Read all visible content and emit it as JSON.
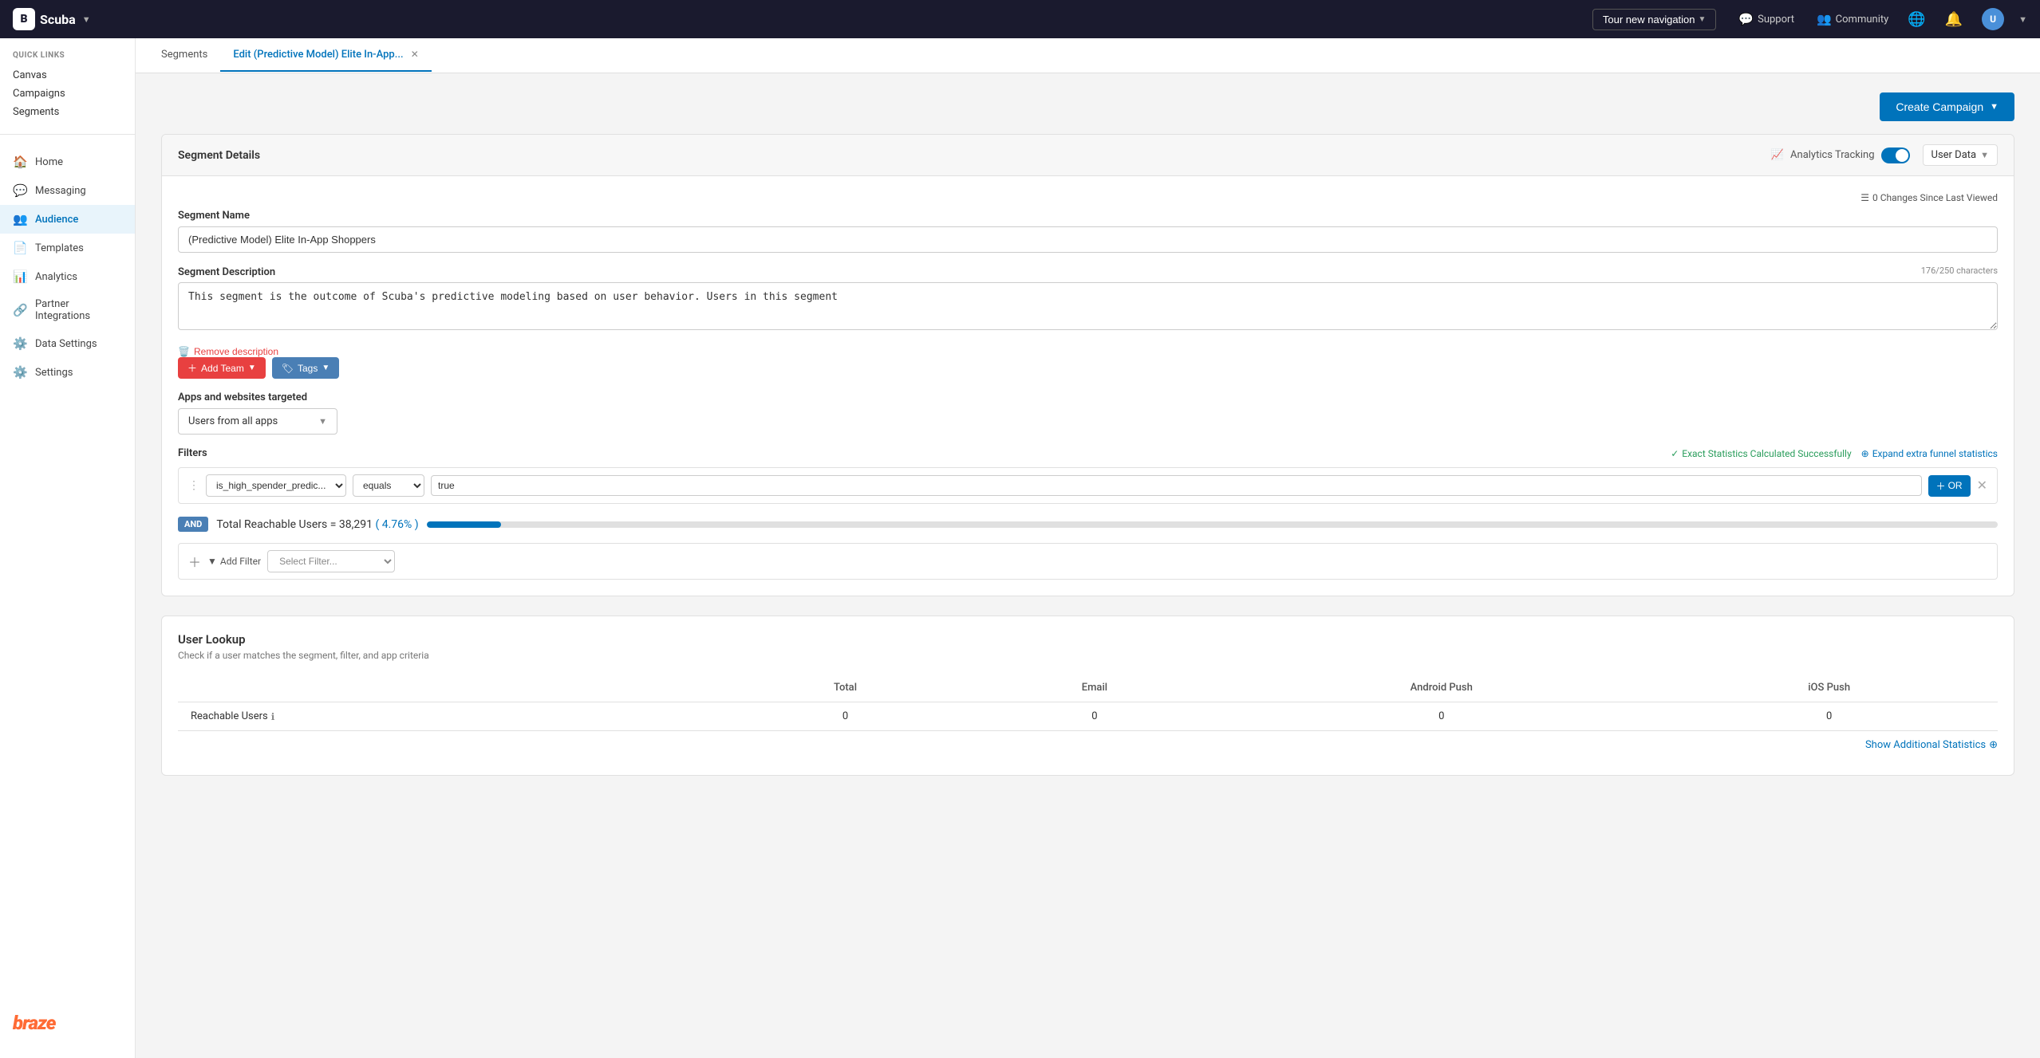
{
  "topNav": {
    "logoText": "B",
    "orgName": "Scuba",
    "tourLabel": "Tour new navigation",
    "supportLabel": "Support",
    "communityLabel": "Community",
    "avatarInitials": "U"
  },
  "sidebar": {
    "quickLinksLabel": "QUICK LINKS",
    "quickLinks": [
      {
        "label": "Canvas"
      },
      {
        "label": "Campaigns"
      },
      {
        "label": "Segments"
      }
    ],
    "navItems": [
      {
        "label": "Home",
        "icon": "🏠"
      },
      {
        "label": "Messaging",
        "icon": "💬"
      },
      {
        "label": "Audience",
        "icon": "👥"
      },
      {
        "label": "Templates",
        "icon": "📄"
      },
      {
        "label": "Analytics",
        "icon": "📊"
      },
      {
        "label": "Partner Integrations",
        "icon": "🔗"
      },
      {
        "label": "Data Settings",
        "icon": "⚙️"
      },
      {
        "label": "Settings",
        "icon": "⚙️"
      }
    ],
    "brazeLogoText": "braze"
  },
  "tabs": [
    {
      "label": "Segments",
      "active": false,
      "closeable": false
    },
    {
      "label": "Edit (Predictive Model) Elite In-App...",
      "active": true,
      "closeable": true
    }
  ],
  "createCampaignBtn": "Create Campaign",
  "segmentDetails": {
    "title": "Segment Details",
    "analyticsTrackingLabel": "Analytics Tracking",
    "userDataLabel": "User Data",
    "changesLabel": "0 Changes Since Last Viewed",
    "segmentNameLabel": "Segment Name",
    "segmentNameValue": "(Predictive Model) Elite In-App Shoppers",
    "segmentDescLabel": "Segment Description",
    "segmentDescCharCount": "176/250 characters",
    "segmentDescValue": "This segment is the outcome of Scuba's predictive modeling based on user behavior. Users in this segment",
    "removeDescLabel": "Remove description",
    "addTeamLabel": "Add Team",
    "tagsLabel": "Tags",
    "appsLabel": "Apps and websites targeted",
    "appsValue": "Users from all apps",
    "filtersTitle": "Filters",
    "exactStatsLabel": "Exact Statistics Calculated Successfully",
    "expandFunnelLabel": "Expand extra funnel statistics",
    "filter": {
      "fieldValue": "is_high_spender_predic...",
      "operatorValue": "equals",
      "valueValue": "true",
      "orLabel": "OR"
    },
    "andBadge": "AND",
    "reachableUsersText": "Total Reachable Users = 38,291 (4.76%)",
    "reachableCount": "38,291",
    "reachablePct": "4.76%",
    "progressPct": 4.76,
    "addFilterLabel": "Add Filter",
    "selectFilterPlaceholder": "Select Filter..."
  },
  "userLookup": {
    "title": "User Lookup",
    "description": "Check if a user matches the segment, filter, and app criteria",
    "table": {
      "headers": [
        "",
        "Total",
        "Email",
        "Android Push",
        "iOS Push"
      ],
      "rows": [
        {
          "label": "Reachable Users",
          "hasInfo": true,
          "values": [
            "0",
            "0",
            "0",
            "0"
          ]
        }
      ]
    },
    "showAdditionalStats": "Show Additional Statistics"
  }
}
